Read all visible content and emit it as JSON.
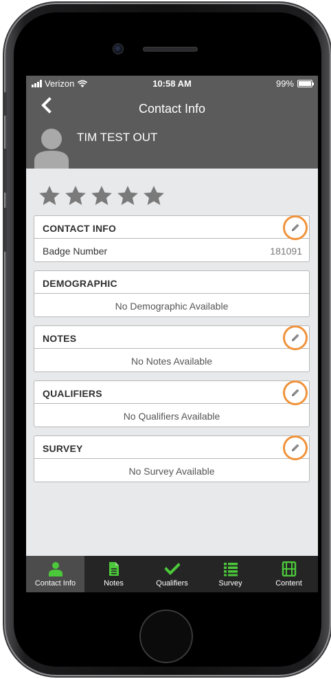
{
  "status_bar": {
    "carrier": "Verizon",
    "time": "10:58 AM",
    "battery": "99%",
    "battery_level": 0.99
  },
  "nav": {
    "title": "Contact Info",
    "back_icon": "chevron-left-icon"
  },
  "contact": {
    "name": "TIM TEST OUT",
    "rating": 0,
    "rating_max": 5
  },
  "sections": {
    "contact_info": {
      "title": "CONTACT INFO",
      "row_label": "Badge Number",
      "row_value": "181091"
    },
    "demographic": {
      "title": "DEMOGRAPHIC",
      "empty": "No Demographic Available"
    },
    "notes": {
      "title": "NOTES",
      "empty": "No Notes Available"
    },
    "qualifiers": {
      "title": "QUALIFIERS",
      "empty": "No Qualifiers Available"
    },
    "survey": {
      "title": "SURVEY",
      "empty": "No Survey Available"
    }
  },
  "tabs": [
    {
      "label": "Contact Info",
      "icon": "person-icon",
      "active": true
    },
    {
      "label": "Notes",
      "icon": "document-icon",
      "active": false
    },
    {
      "label": "Qualifiers",
      "icon": "checkmark-icon",
      "active": false
    },
    {
      "label": "Survey",
      "icon": "list-icon",
      "active": false
    },
    {
      "label": "Content",
      "icon": "film-icon",
      "active": false
    }
  ],
  "colors": {
    "header_bg": "#5b5b5b",
    "screen_bg": "#e8e9ea",
    "tab_bar_bg": "#252525",
    "tab_active_bg": "#4c4c4c",
    "tab_icon": "#4cc93a",
    "edit_highlight": "#f0923a",
    "star_empty": "#7a7a7a"
  }
}
